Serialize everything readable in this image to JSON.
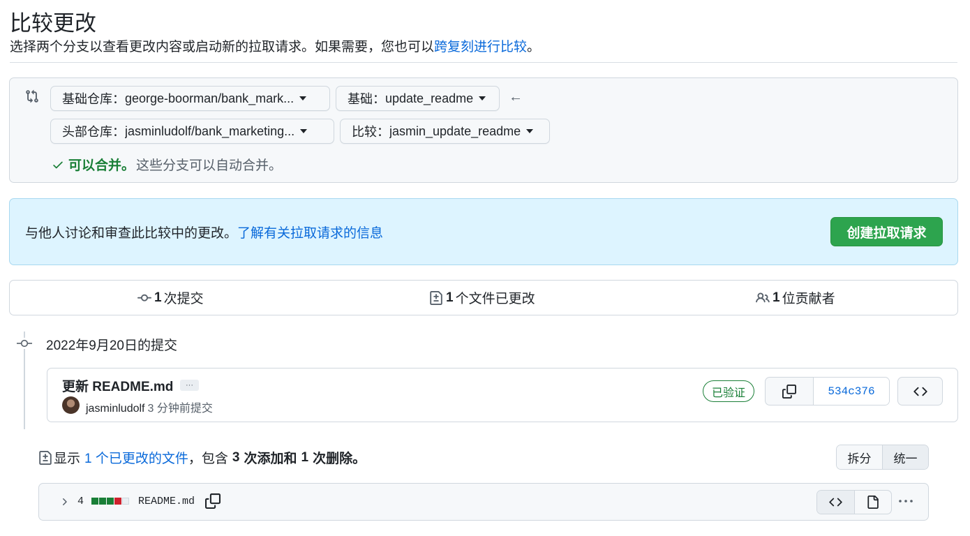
{
  "header": {
    "title": "比较更改",
    "subtitle_prefix": "选择两个分支以查看更改内容或启动新的拉取请求。如果需要，您也可以",
    "subtitle_link": "跨复刻进行比较",
    "subtitle_suffix": "。"
  },
  "range": {
    "base_repo_label": "基础仓库：",
    "base_repo_value": "george-boorman/bank_mark...",
    "base_label": "基础：",
    "base_value": "update_readme",
    "head_repo_label": "头部仓库：",
    "head_repo_value": "jasminludolf/bank_marketing...",
    "compare_label": "比较：",
    "compare_value": "jasmin_update_readme",
    "arrow": "←",
    "merge_ok": "可以合并。",
    "merge_msg": "这些分支可以自动合并。"
  },
  "info": {
    "text": "与他人讨论和审查此比较中的更改。",
    "link": "了解有关拉取请求的信息",
    "create_button": "创建拉取请求"
  },
  "stats": {
    "commits_count": "1",
    "commits_label": "次提交",
    "files_count": "1",
    "files_label": "个文件已更改",
    "contributors_count": "1",
    "contributors_label": "位贡献者"
  },
  "commit_group": {
    "date": "2022年9月20日的提交",
    "commit": {
      "title": "更新 README.md",
      "ellipsis": "···",
      "author": "jasminludolf",
      "when": "3 分钟前提交",
      "verified": "已验证",
      "sha": "534c376"
    }
  },
  "summary": {
    "prefix": "显示",
    "link": "1 个已更改的文件",
    "middle": "，包含",
    "additions": "3",
    "additions_label": "次添加和",
    "deletions": "1",
    "deletions_label": "次删除。"
  },
  "view_toggle": {
    "split": "拆分",
    "unified": "统一",
    "selected": "unified"
  },
  "file": {
    "changes": "4",
    "name": "README.md",
    "diffstat": [
      "added",
      "added",
      "added",
      "deleted",
      "neutral"
    ]
  },
  "colors": {
    "link": "#0969da",
    "success": "#1a7f37",
    "button_green": "#2da44e",
    "deleted": "#cf222e",
    "neutral": "#d0d7de",
    "info_bg": "#ddf4ff"
  },
  "icons": {
    "compare": "git-compare-icon",
    "commit": "git-commit-icon",
    "file_diff": "file-diff-icon",
    "people": "people-icon",
    "check": "check-icon",
    "copy": "copy-icon",
    "code": "code-icon",
    "file": "file-icon",
    "chevron": "chevron-right-icon",
    "kebab": "kebab-horizontal-icon"
  }
}
